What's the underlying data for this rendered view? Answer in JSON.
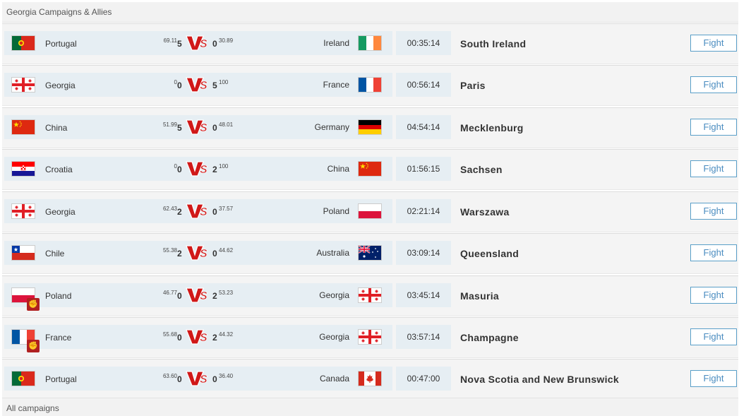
{
  "header": {
    "title": "Georgia Campaigns & Allies"
  },
  "footer": {
    "link": "All campaigns"
  },
  "battles": [
    {
      "left_country": "Portugal",
      "left_flag": "portugal",
      "left_pct": "69.11",
      "left_score": "5",
      "right_score": "0",
      "right_pct": "30.89",
      "right_country": "Ireland",
      "right_flag": "ireland",
      "time": "00:35:14",
      "region": "South Ireland",
      "fight_label": "Fight"
    },
    {
      "left_country": "Georgia",
      "left_flag": "georgia",
      "left_pct": "0",
      "left_score": "0",
      "right_score": "5",
      "right_pct": "100",
      "right_country": "France",
      "right_flag": "france",
      "time": "00:56:14",
      "region": "Paris",
      "fight_label": "Fight"
    },
    {
      "left_country": "China",
      "left_flag": "china",
      "left_pct": "51.99",
      "left_score": "5",
      "right_score": "0",
      "right_pct": "48.01",
      "right_country": "Germany",
      "right_flag": "germany",
      "time": "04:54:14",
      "region": "Mecklenburg",
      "fight_label": "Fight"
    },
    {
      "left_country": "Croatia",
      "left_flag": "croatia",
      "left_pct": "0",
      "left_score": "0",
      "right_score": "2",
      "right_pct": "100",
      "right_country": "China",
      "right_flag": "china",
      "time": "01:56:15",
      "region": "Sachsen",
      "fight_label": "Fight"
    },
    {
      "left_country": "Georgia",
      "left_flag": "georgia",
      "left_pct": "62.43",
      "left_score": "2",
      "right_score": "0",
      "right_pct": "37.57",
      "right_country": "Poland",
      "right_flag": "poland",
      "time": "02:21:14",
      "region": "Warszawa",
      "fight_label": "Fight"
    },
    {
      "left_country": "Chile",
      "left_flag": "chile",
      "left_pct": "55.38",
      "left_score": "2",
      "right_score": "0",
      "right_pct": "44.62",
      "right_country": "Australia",
      "right_flag": "australia",
      "time": "03:09:14",
      "region": "Queensland",
      "fight_label": "Fight"
    },
    {
      "left_country": "Poland",
      "left_flag": "poland",
      "left_resistance": true,
      "left_pct": "46.77",
      "left_score": "0",
      "right_score": "2",
      "right_pct": "53.23",
      "right_country": "Georgia",
      "right_flag": "georgia",
      "time": "03:45:14",
      "region": "Masuria",
      "fight_label": "Fight"
    },
    {
      "left_country": "France",
      "left_flag": "france",
      "left_resistance": true,
      "left_pct": "55.68",
      "left_score": "0",
      "right_score": "2",
      "right_pct": "44.32",
      "right_country": "Georgia",
      "right_flag": "georgia",
      "time": "03:57:14",
      "region": "Champagne",
      "fight_label": "Fight"
    },
    {
      "left_country": "Portugal",
      "left_flag": "portugal",
      "left_pct": "63.60",
      "left_score": "0",
      "right_score": "0",
      "right_pct": "36.40",
      "right_country": "Canada",
      "right_flag": "canada",
      "time": "00:47:00",
      "region": "Nova Scotia and New Brunswick",
      "fight_label": "Fight"
    }
  ],
  "colors": {
    "accent": "#4a8cc0",
    "panel": "#e6eef3",
    "vs_red": "#d01818"
  }
}
